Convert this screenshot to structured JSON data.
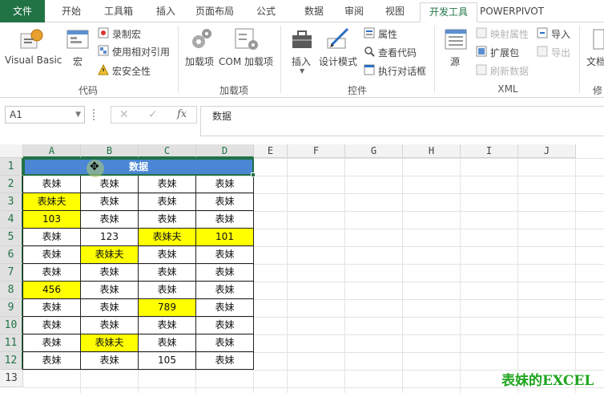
{
  "ribbon_tabs": [
    {
      "label": "文件",
      "kind": "file"
    },
    {
      "label": "开始",
      "kind": "normal"
    },
    {
      "label": "工具箱",
      "kind": "normal"
    },
    {
      "label": "插入",
      "kind": "normal"
    },
    {
      "label": "页面布局",
      "kind": "normal"
    },
    {
      "label": "公式",
      "kind": "normal"
    },
    {
      "label": "数据",
      "kind": "normal"
    },
    {
      "label": "审阅",
      "kind": "normal"
    },
    {
      "label": "视图",
      "kind": "normal"
    },
    {
      "label": "开发工具",
      "kind": "active"
    },
    {
      "label": "POWERPIVOT",
      "kind": "normal"
    }
  ],
  "ribbon": {
    "code": {
      "group_label": "代码",
      "visual_basic": "Visual Basic",
      "macros": "宏",
      "record_macro": "录制宏",
      "relative_ref": "使用相对引用",
      "macro_security": "宏安全性"
    },
    "addins": {
      "group_label": "加载项",
      "addins_btn": "加载项",
      "com_addins": "COM 加载项"
    },
    "controls": {
      "group_label": "控件",
      "insert": "插入",
      "design_mode": "设计模式",
      "properties": "属性",
      "view_code": "查看代码",
      "run_dialog": "执行对话框"
    },
    "xml": {
      "group_label": "XML",
      "source": "源",
      "map_props": "映射属性",
      "expansion": "扩展包",
      "refresh": "刷新数据",
      "import": "导入",
      "export": "导出"
    },
    "doc": {
      "doc_panel": "文档",
      "group_label": "修"
    }
  },
  "formula_bar": {
    "name_box": "A1",
    "cancel": "✕",
    "enter": "✓",
    "fx": "fx",
    "content": "数据"
  },
  "columns": [
    "A",
    "B",
    "C",
    "D",
    "E",
    "F",
    "G",
    "H",
    "I",
    "J"
  ],
  "rows": [
    "1",
    "2",
    "3",
    "4",
    "5",
    "6",
    "7",
    "8",
    "9",
    "10",
    "11",
    "12",
    "13"
  ],
  "table": {
    "header": "数据",
    "rows": [
      [
        {
          "v": "表妹"
        },
        {
          "v": "表妹"
        },
        {
          "v": "表妹"
        },
        {
          "v": "表妹"
        }
      ],
      [
        {
          "v": "表妹夫",
          "hl": true
        },
        {
          "v": "表妹"
        },
        {
          "v": "表妹"
        },
        {
          "v": "表妹"
        }
      ],
      [
        {
          "v": "103",
          "hl": true
        },
        {
          "v": "表妹"
        },
        {
          "v": "表妹"
        },
        {
          "v": "表妹"
        }
      ],
      [
        {
          "v": "表妹"
        },
        {
          "v": "123"
        },
        {
          "v": "表妹夫",
          "hl": true
        },
        {
          "v": "101",
          "hl": true
        }
      ],
      [
        {
          "v": "表妹"
        },
        {
          "v": "表妹夫",
          "hl": true
        },
        {
          "v": "表妹"
        },
        {
          "v": "表妹"
        }
      ],
      [
        {
          "v": "表妹"
        },
        {
          "v": "表妹"
        },
        {
          "v": "表妹"
        },
        {
          "v": "表妹"
        }
      ],
      [
        {
          "v": "456",
          "hl": true
        },
        {
          "v": "表妹"
        },
        {
          "v": "表妹"
        },
        {
          "v": "表妹"
        }
      ],
      [
        {
          "v": "表妹"
        },
        {
          "v": "表妹"
        },
        {
          "v": "789",
          "hl": true
        },
        {
          "v": "表妹"
        }
      ],
      [
        {
          "v": "表妹"
        },
        {
          "v": "表妹"
        },
        {
          "v": "表妹"
        },
        {
          "v": "表妹"
        }
      ],
      [
        {
          "v": "表妹"
        },
        {
          "v": "表妹夫",
          "hl": true
        },
        {
          "v": "表妹"
        },
        {
          "v": "表妹"
        }
      ],
      [
        {
          "v": "表妹"
        },
        {
          "v": "表妹"
        },
        {
          "v": "105"
        },
        {
          "v": "表妹"
        }
      ]
    ]
  },
  "watermark": "表妹的EXCEL",
  "colors": {
    "accent": "#217346",
    "header_fill": "#4a86d4",
    "highlight": "#ffff00",
    "watermark": "#1ea51e"
  }
}
